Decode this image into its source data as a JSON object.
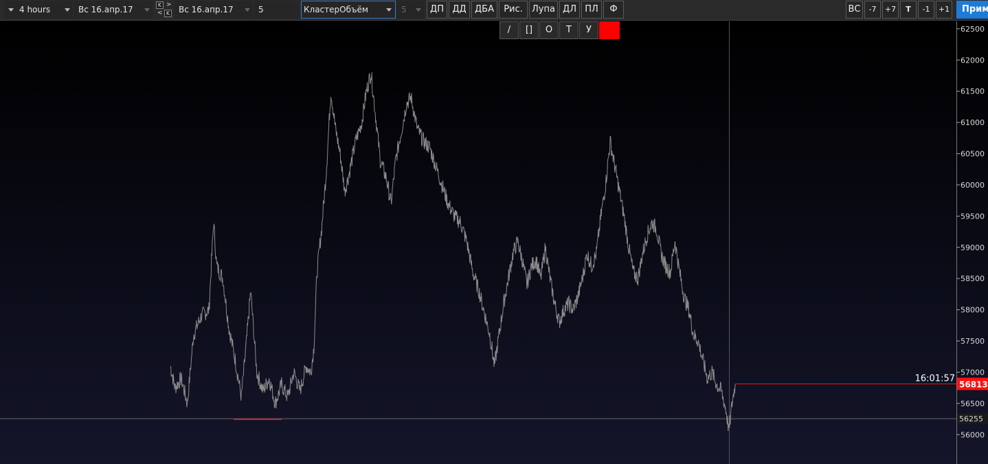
{
  "toolbar": {
    "timeframe": "4 hours",
    "date_from": "Вс 16.апр.17",
    "date_to": "Вс 16.апр.17",
    "k_top": "K",
    "k_bottom": "K",
    "k_gt": ">",
    "k_lt": "<",
    "count": "5",
    "indicator": "КластерОбъём",
    "indicator_param": "5",
    "buttons": [
      "ДП",
      "ДД",
      "ДБА",
      "Рис.",
      "Лупа",
      "ДЛ",
      "ПЛ",
      "Ф"
    ],
    "right_buttons": [
      "ВС",
      "-7",
      "+7",
      "T",
      "-1",
      "+1"
    ],
    "apply_label": "Прим"
  },
  "drawing_tools": [
    "/",
    "[]",
    "O",
    "T",
    "У"
  ],
  "colors": {
    "background_top": "#000000",
    "background_bottom": "#14152a",
    "price_line": "#8c8c8c",
    "current_price": "#ff1010",
    "accent": "#1e7bd8"
  },
  "chart_data": {
    "type": "line",
    "y_ticks": [
      56000,
      56500,
      57000,
      57500,
      58000,
      58500,
      59000,
      59500,
      60000,
      60500,
      61000,
      61500,
      62000,
      62500
    ],
    "ylim": [
      55530,
      62620
    ],
    "current_price": 56813,
    "current_time": "16:01:57",
    "horizontal_level": 56255,
    "series": [
      {
        "points": [
          [
            0,
            57100
          ],
          [
            3,
            56750
          ],
          [
            7,
            56900
          ],
          [
            11,
            56500
          ],
          [
            15,
            57600
          ],
          [
            20,
            57900
          ],
          [
            25,
            58000
          ],
          [
            28,
            59400
          ],
          [
            30,
            58700
          ],
          [
            34,
            58500
          ],
          [
            38,
            57700
          ],
          [
            42,
            57200
          ],
          [
            46,
            56600
          ],
          [
            49,
            57400
          ],
          [
            52,
            58300
          ],
          [
            56,
            57000
          ],
          [
            60,
            56700
          ],
          [
            64,
            56900
          ],
          [
            68,
            56500
          ],
          [
            72,
            56800
          ],
          [
            76,
            56600
          ],
          [
            80,
            57000
          ],
          [
            84,
            56700
          ],
          [
            88,
            57100
          ],
          [
            91,
            57000
          ],
          [
            93,
            57400
          ],
          [
            95,
            58600
          ],
          [
            98,
            59300
          ],
          [
            101,
            60200
          ],
          [
            104,
            61500
          ],
          [
            107,
            60900
          ],
          [
            110,
            60500
          ],
          [
            113,
            59900
          ],
          [
            116,
            60200
          ],
          [
            120,
            60700
          ],
          [
            124,
            61000
          ],
          [
            127,
            61500
          ],
          [
            130,
            61800
          ],
          [
            133,
            61100
          ],
          [
            136,
            60400
          ],
          [
            140,
            60100
          ],
          [
            143,
            59700
          ],
          [
            146,
            60400
          ],
          [
            150,
            60900
          ],
          [
            153,
            61300
          ],
          [
            156,
            61400
          ],
          [
            160,
            60900
          ],
          [
            164,
            60700
          ],
          [
            168,
            60600
          ],
          [
            172,
            60300
          ],
          [
            176,
            60000
          ],
          [
            180,
            59700
          ],
          [
            184,
            59500
          ],
          [
            188,
            59400
          ],
          [
            192,
            59100
          ],
          [
            196,
            58600
          ],
          [
            200,
            58300
          ],
          [
            204,
            57900
          ],
          [
            207,
            57600
          ],
          [
            210,
            57100
          ],
          [
            213,
            57600
          ],
          [
            216,
            58100
          ],
          [
            219,
            58500
          ],
          [
            222,
            58900
          ],
          [
            225,
            59100
          ],
          [
            228,
            58800
          ],
          [
            231,
            58400
          ],
          [
            234,
            58700
          ],
          [
            237,
            58800
          ],
          [
            240,
            58500
          ],
          [
            243,
            59000
          ],
          [
            246,
            58500
          ],
          [
            249,
            58100
          ],
          [
            252,
            57800
          ],
          [
            255,
            58000
          ],
          [
            258,
            58100
          ],
          [
            261,
            58000
          ],
          [
            264,
            58200
          ],
          [
            267,
            58500
          ],
          [
            270,
            58900
          ],
          [
            273,
            58700
          ],
          [
            276,
            58900
          ],
          [
            279,
            59500
          ],
          [
            282,
            60000
          ],
          [
            285,
            60700
          ],
          [
            288,
            60300
          ],
          [
            291,
            59900
          ],
          [
            294,
            59500
          ],
          [
            297,
            59000
          ],
          [
            300,
            58600
          ],
          [
            303,
            58500
          ],
          [
            306,
            58900
          ],
          [
            309,
            59200
          ],
          [
            312,
            59400
          ],
          [
            315,
            59300
          ],
          [
            318,
            58900
          ],
          [
            321,
            58700
          ],
          [
            324,
            58600
          ],
          [
            327,
            59100
          ],
          [
            330,
            58600
          ],
          [
            333,
            58200
          ],
          [
            336,
            58000
          ],
          [
            339,
            57600
          ],
          [
            342,
            57500
          ],
          [
            345,
            57200
          ],
          [
            348,
            56900
          ],
          [
            351,
            57000
          ],
          [
            354,
            56800
          ],
          [
            357,
            56700
          ],
          [
            360,
            56400
          ],
          [
            362,
            56060
          ],
          [
            364,
            56500
          ],
          [
            366,
            56813
          ]
        ]
      }
    ]
  }
}
